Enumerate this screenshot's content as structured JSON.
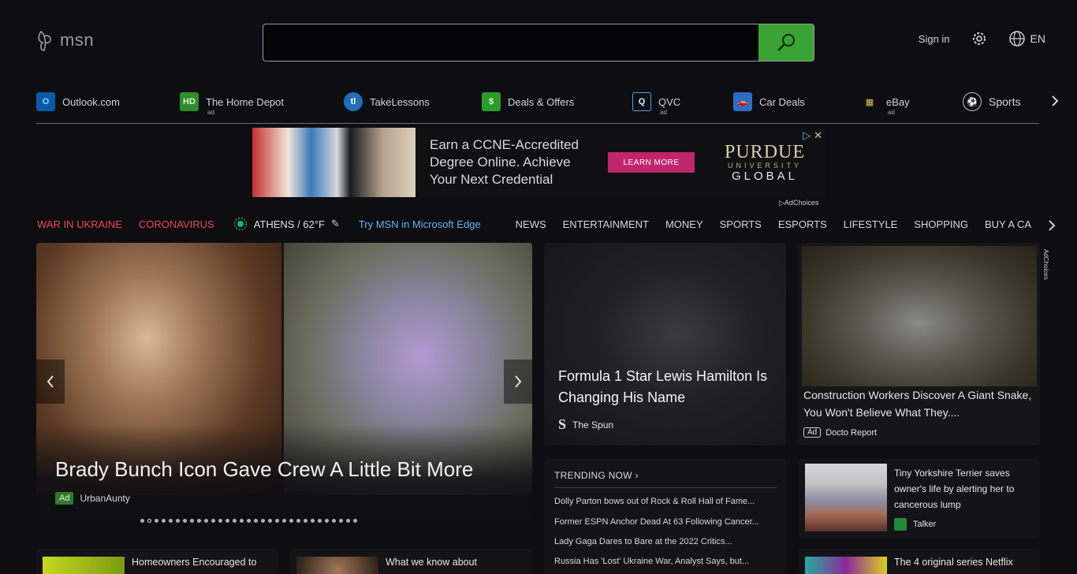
{
  "header": {
    "logo_text": "msn",
    "search_value": "",
    "signin": "Sign in",
    "language": "EN"
  },
  "quick_links": [
    {
      "label": "Outlook.com",
      "ad": ""
    },
    {
      "label": "The Home Depot",
      "ad": "ad"
    },
    {
      "label": "TakeLessons",
      "ad": ""
    },
    {
      "label": "Deals & Offers",
      "ad": ""
    },
    {
      "label": "QVC",
      "ad": "ad"
    },
    {
      "label": "Car Deals",
      "ad": ""
    },
    {
      "label": "eBay",
      "ad": "ad"
    },
    {
      "label": "Sports",
      "ad": ""
    }
  ],
  "banner": {
    "copy": "Earn a CCNE-Accredited Degree Online. Achieve Your Next Credential",
    "cta": "LEARN MORE",
    "brand_1": "PURDUE",
    "brand_2": "UNIVERSITY",
    "brand_3": "GLOBAL",
    "adchoices": "AdChoices"
  },
  "nav": {
    "topic_1": "WAR IN UKRAINE",
    "topic_2": "CORONAVIRUS",
    "weather": "ATHENS / 62°F",
    "edge_link": "Try MSN in Microsoft Edge",
    "categories": [
      "NEWS",
      "ENTERTAINMENT",
      "MONEY",
      "SPORTS",
      "ESPORTS",
      "LIFESTYLE",
      "SHOPPING",
      "BUY A CA"
    ]
  },
  "hero": {
    "title": "Brady Bunch Icon Gave Crew A Little Bit More",
    "ad_label": "Ad",
    "source": "UrbanAunty",
    "dot_count": 31,
    "active_dot": 1
  },
  "cards": {
    "f1": {
      "headline": "Formula 1 Star Lewis Hamilton Is Changing His Name",
      "source": "The Spun",
      "source_logo": "S"
    },
    "snake": {
      "headline": "Construction Workers Discover A Giant Snake, You Won't Believe What They....",
      "ad_label": "Ad",
      "source": "Docto Report",
      "side_label": "AdChoices"
    },
    "trending": {
      "header": "TRENDING NOW ›",
      "items": [
        "Dolly Parton bows out of Rock & Roll Hall of Fame...",
        "Former ESPN Anchor Dead At 63 Following Cancer...",
        "Lady Gaga Dares to Bare at the 2022 Critics...",
        "Russia Has 'Lost' Ukraine War, Analyst Says, but..."
      ]
    },
    "dog": {
      "headline": "Tiny Yorkshire Terrier saves owner's life by alerting her to cancerous lump",
      "source": "Talker"
    },
    "bottom_1": {
      "headline": "Homeowners Encouraged to"
    },
    "bottom_2": {
      "headline": "What we know about"
    },
    "bottom_3": {
      "headline": "The 4 original series Netflix"
    }
  },
  "colors": {
    "background": "#0e0e12",
    "search_button": "#3aa335",
    "topic_red": "#f04848",
    "edge_blue": "#64b4f6",
    "cta_pink": "#c0266c",
    "ad_green": "#2f7a2c"
  }
}
